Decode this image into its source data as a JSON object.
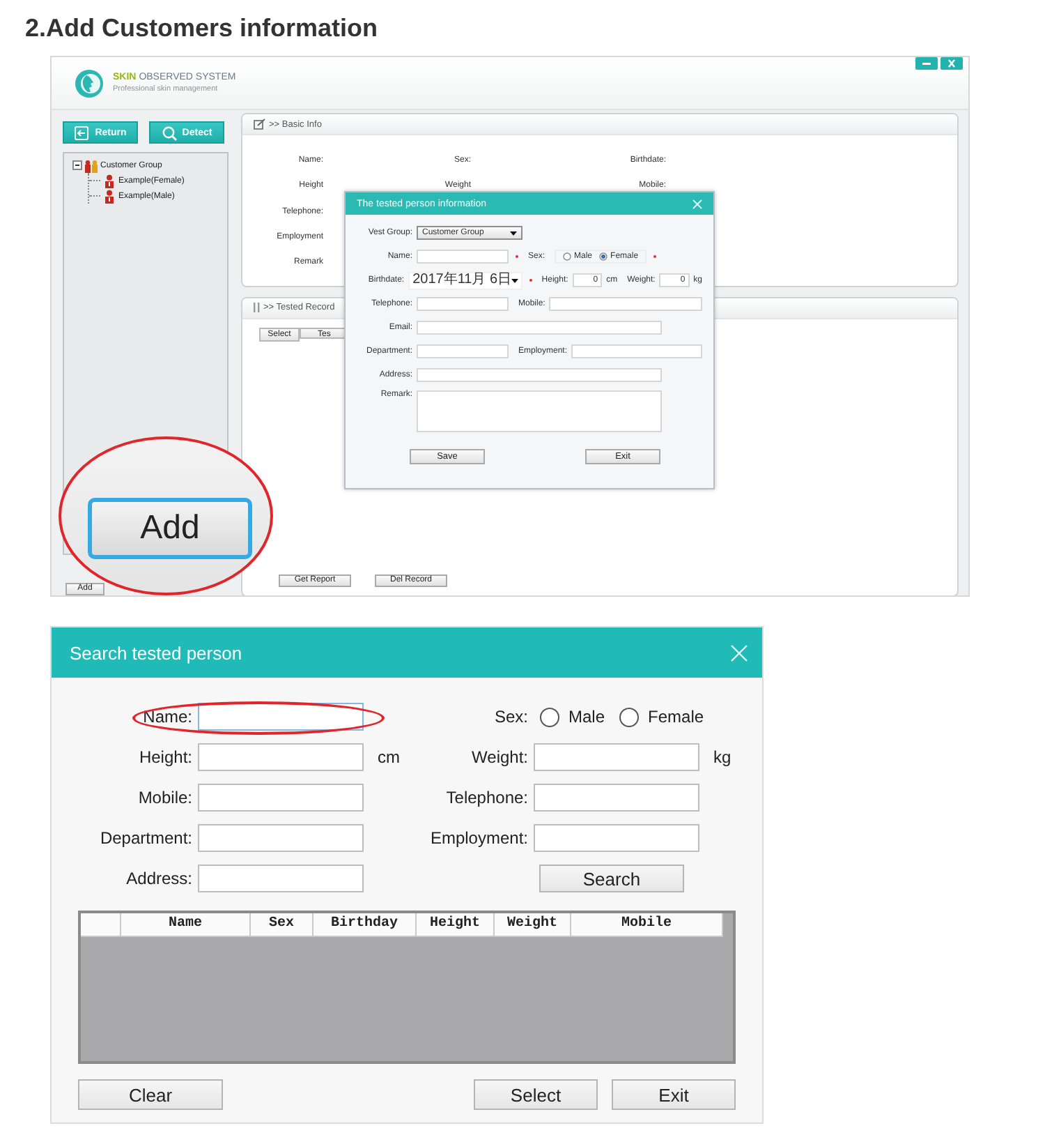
{
  "heading": "2.Add Customers information",
  "app": {
    "logo": {
      "brand": "SKIN",
      "title": "OBSERVED SYSTEM",
      "subtitle": "Professional skin management"
    },
    "window_buttons": [
      {
        "kind": "minimize"
      },
      {
        "kind": "close"
      }
    ],
    "toolbar": [
      {
        "label": "Return"
      },
      {
        "label": "Detect"
      }
    ],
    "tree": [
      {
        "label": "Customer Group",
        "kind": "group",
        "expanded": true,
        "children": [
          {
            "label": "Example(Female)",
            "kind": "person"
          },
          {
            "label": "Example(Male)",
            "kind": "person"
          }
        ]
      }
    ],
    "add_button": "Add",
    "basic_info": {
      "title": ">> Basic Info",
      "rows": [
        [
          "Name:",
          "Sex:",
          "Birthdate:"
        ],
        [
          "Height",
          "Weight",
          "Mobile:"
        ],
        [
          "Telephone:"
        ],
        [
          "Employment"
        ],
        [
          "Remark"
        ]
      ]
    },
    "tested_record": {
      "title": ">> Tested Record",
      "columns": [
        "Select",
        "Tes"
      ],
      "buttons": [
        "Get Report",
        "Del Record"
      ]
    },
    "dialog": {
      "title": "The tested person information",
      "rows": [
        [
          {
            "kind": "select",
            "label": "Vest Group:",
            "value": "Customer Group",
            "required": false
          }
        ],
        [
          {
            "kind": "text",
            "label": "Name:",
            "required": true
          },
          {
            "kind": "radio",
            "label": "Sex:",
            "required": true,
            "options": [
              {
                "label": "Male",
                "selected": false
              },
              {
                "label": "Female",
                "selected": true
              }
            ]
          }
        ],
        [
          {
            "kind": "date",
            "label": "Birthdate:",
            "value": "2017年11月 6日",
            "required": true
          },
          {
            "kind": "number",
            "label": "Height:",
            "value": "0",
            "unit": "cm",
            "required": false
          },
          {
            "kind": "number",
            "label": "Weight:",
            "value": "0",
            "unit": "kg",
            "required": false
          }
        ],
        [
          {
            "kind": "text",
            "label": "Telephone:",
            "required": false
          },
          {
            "kind": "text",
            "label": "Mobile:",
            "required": false
          }
        ],
        [
          {
            "kind": "text",
            "label": "Email:",
            "required": false
          }
        ],
        [
          {
            "kind": "text",
            "label": "Department:",
            "required": false
          },
          {
            "kind": "text",
            "label": "Employment:",
            "required": false
          }
        ],
        [
          {
            "kind": "text",
            "label": "Address:",
            "required": false
          }
        ],
        [
          {
            "kind": "textarea",
            "label": "Remark:",
            "required": false
          }
        ]
      ],
      "buttons": [
        "Save",
        "Exit"
      ]
    },
    "callout": {
      "label": "Add"
    }
  },
  "search": {
    "title": "Search tested person",
    "rows": [
      [
        {
          "kind": "text",
          "label": "Name:",
          "focused": true,
          "highlighted": true
        },
        {
          "kind": "radio",
          "label": "Sex:",
          "options": [
            {
              "label": "Male",
              "selected": false
            },
            {
              "label": "Female",
              "selected": false
            }
          ]
        }
      ],
      [
        {
          "kind": "text",
          "label": "Height:",
          "unit": "cm",
          "focused": false,
          "highlighted": false
        },
        {
          "kind": "text",
          "label": "Weight:",
          "unit": "kg",
          "focused": false,
          "highlighted": false
        }
      ],
      [
        {
          "kind": "text",
          "label": "Mobile:",
          "focused": false,
          "highlighted": false
        },
        {
          "kind": "text",
          "label": "Telephone:",
          "focused": false,
          "highlighted": false
        }
      ],
      [
        {
          "kind": "text",
          "label": "Department:",
          "focused": false,
          "highlighted": false
        },
        {
          "kind": "text",
          "label": "Employment:",
          "focused": false,
          "highlighted": false
        }
      ],
      [
        {
          "kind": "text",
          "label": "Address:",
          "focused": false,
          "highlighted": false
        },
        {
          "kind": "button",
          "label": "Search"
        }
      ]
    ],
    "table": {
      "columns": [
        "Name",
        "Sex",
        "Birthday",
        "Height",
        "Weight",
        "Mobile"
      ]
    },
    "buttons": [
      "Clear",
      "Select",
      "Exit"
    ]
  }
}
